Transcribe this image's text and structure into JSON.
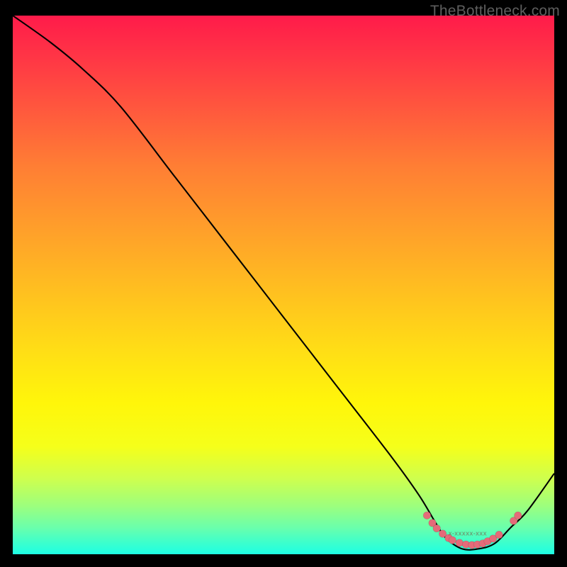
{
  "watermark": "TheBottleneck.com",
  "colors": {
    "background": "#000000",
    "curve": "#000000",
    "scatter": "#e46b79",
    "watermark_text": "#5e5e5e"
  },
  "chart_data": {
    "type": "line",
    "title": "",
    "xlabel": "",
    "ylabel": "",
    "xlim": [
      0,
      100
    ],
    "ylim": [
      0,
      100
    ],
    "series": [
      {
        "name": "bottleneck-curve",
        "x": [
          0,
          7,
          13,
          20,
          30,
          40,
          50,
          60,
          70,
          75,
          78,
          80,
          83,
          86,
          89,
          92,
          95,
          100
        ],
        "y": [
          100,
          95,
          90,
          83,
          70,
          57,
          44,
          31,
          18,
          11,
          6,
          3,
          1,
          1,
          2,
          5,
          8,
          15
        ]
      }
    ],
    "annotations": [
      {
        "text": "x-xxxxx-xxx",
        "x": 84,
        "y": 3.5
      }
    ],
    "scatter": {
      "name": "highlight-points",
      "points": [
        {
          "x": 76.5,
          "y": 7.2
        },
        {
          "x": 77.5,
          "y": 5.8
        },
        {
          "x": 78.3,
          "y": 4.8
        },
        {
          "x": 79.4,
          "y": 3.8
        },
        {
          "x": 80.5,
          "y": 3.0
        },
        {
          "x": 81.2,
          "y": 2.6
        },
        {
          "x": 82.5,
          "y": 2.1
        },
        {
          "x": 83.7,
          "y": 1.8
        },
        {
          "x": 84.8,
          "y": 1.7
        },
        {
          "x": 85.8,
          "y": 1.8
        },
        {
          "x": 86.8,
          "y": 2.0
        },
        {
          "x": 87.7,
          "y": 2.4
        },
        {
          "x": 88.7,
          "y": 2.9
        },
        {
          "x": 89.8,
          "y": 3.6
        },
        {
          "x": 92.5,
          "y": 6.2
        },
        {
          "x": 93.3,
          "y": 7.2
        }
      ]
    }
  }
}
